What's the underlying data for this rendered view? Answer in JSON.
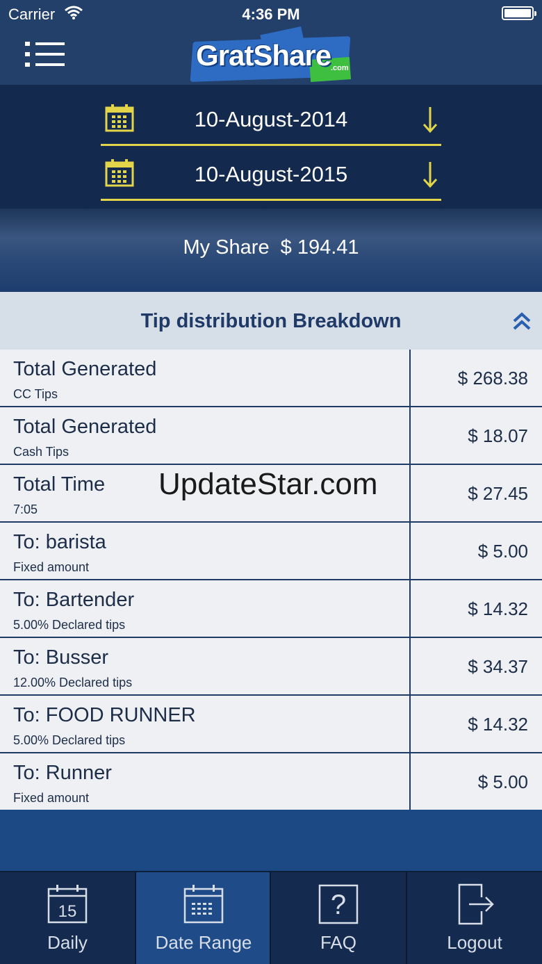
{
  "status_bar": {
    "carrier": "Carrier",
    "time": "4:36 PM"
  },
  "nav": {
    "logo_text": "GratShare",
    "logo_suffix": ".com"
  },
  "date_range": {
    "from": "10-August-2014",
    "to": "10-August-2015"
  },
  "share": {
    "label": "My Share",
    "amount": "$ 194.41"
  },
  "breakdown": {
    "title": "Tip distribution Breakdown",
    "rows": [
      {
        "label": "Total Generated",
        "sub": "CC Tips",
        "value": "$ 268.38"
      },
      {
        "label": "Total Generated",
        "sub": "Cash Tips",
        "value": "$ 18.07"
      },
      {
        "label": "Total Time",
        "sub": "7:05",
        "value": "$ 27.45"
      },
      {
        "label": "To: barista",
        "sub": "Fixed amount",
        "value": "$ 5.00"
      },
      {
        "label": "To: Bartender",
        "sub": "5.00% Declared tips",
        "value": "$ 14.32"
      },
      {
        "label": "To: Busser",
        "sub": "12.00% Declared tips",
        "value": "$ 34.37"
      },
      {
        "label": "To: FOOD RUNNER",
        "sub": "5.00% Declared tips",
        "value": "$ 14.32"
      },
      {
        "label": "To: Runner",
        "sub": "Fixed amount",
        "value": "$ 5.00"
      }
    ]
  },
  "watermark": "UpdateStar.com",
  "tabs": [
    {
      "label": "Daily",
      "icon": "calendar-day-icon",
      "day": "15",
      "active": false
    },
    {
      "label": "Date Range",
      "icon": "calendar-range-icon",
      "active": true
    },
    {
      "label": "FAQ",
      "icon": "question-icon",
      "active": false
    },
    {
      "label": "Logout",
      "icon": "logout-icon",
      "active": false
    }
  ],
  "colors": {
    "accent_yellow": "#e3d54a",
    "nav_blue": "#23406a",
    "header_gray": "#d6dee8",
    "active_tab": "#1f4c88"
  }
}
